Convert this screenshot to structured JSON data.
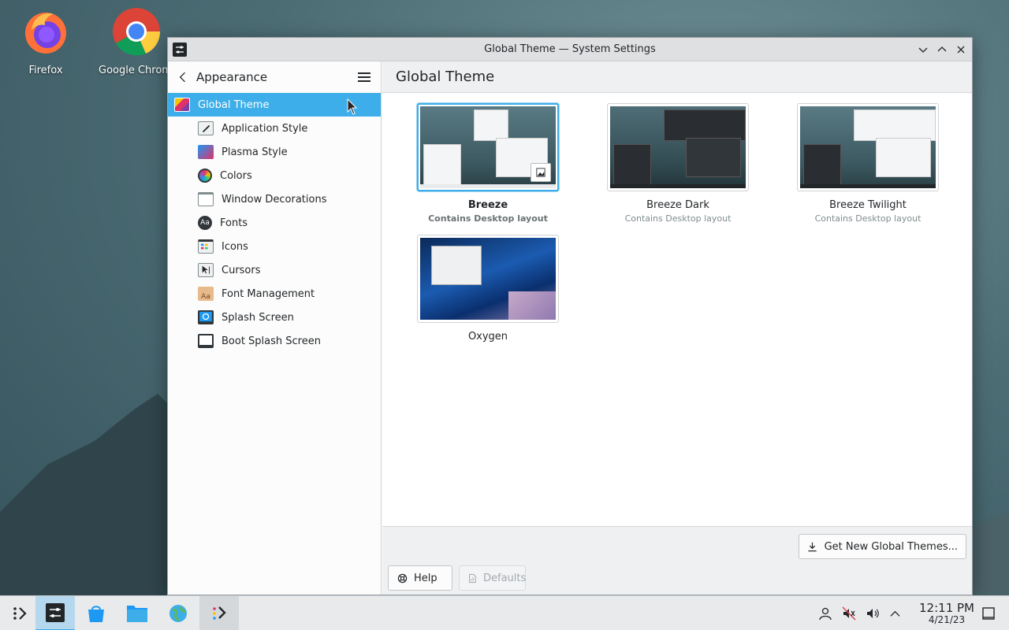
{
  "desktop": {
    "icons": [
      {
        "label": "Firefox",
        "icon": "firefox-icon"
      },
      {
        "label": "Google Chrome",
        "icon": "chrome-icon"
      }
    ]
  },
  "window": {
    "title": "Global Theme — System Settings",
    "sidebar": {
      "header": "Appearance",
      "items": [
        {
          "label": "Global Theme",
          "icon": "global-theme-icon"
        },
        {
          "label": "Application Style",
          "icon": "application-style-icon"
        },
        {
          "label": "Plasma Style",
          "icon": "plasma-style-icon"
        },
        {
          "label": "Colors",
          "icon": "colors-icon"
        },
        {
          "label": "Window Decorations",
          "icon": "window-decorations-icon"
        },
        {
          "label": "Fonts",
          "icon": "fonts-icon"
        },
        {
          "label": "Icons",
          "icon": "icons-icon"
        },
        {
          "label": "Cursors",
          "icon": "cursors-icon"
        },
        {
          "label": "Font Management",
          "icon": "font-management-icon"
        },
        {
          "label": "Splash Screen",
          "icon": "splash-screen-icon"
        },
        {
          "label": "Boot Splash Screen",
          "icon": "boot-splash-screen-icon"
        }
      ]
    },
    "main": {
      "title": "Global Theme",
      "themes": [
        {
          "name": "Breeze",
          "subtitle": "Contains Desktop layout",
          "selected": true
        },
        {
          "name": "Breeze Dark",
          "subtitle": "Contains Desktop layout",
          "selected": false
        },
        {
          "name": "Breeze Twilight",
          "subtitle": "Contains Desktop layout",
          "selected": false
        },
        {
          "name": "Oxygen",
          "subtitle": "",
          "selected": false
        }
      ],
      "get_new_label": "Get New Global Themes...",
      "help_label": "Help",
      "defaults_label": "Defaults"
    }
  },
  "taskbar": {
    "clock_time": "12:11 PM",
    "clock_date": "4/21/23"
  },
  "colors": {
    "accent": "#3daee9",
    "window_bg": "#fcfcfc",
    "header_bg": "#eff0f1"
  }
}
